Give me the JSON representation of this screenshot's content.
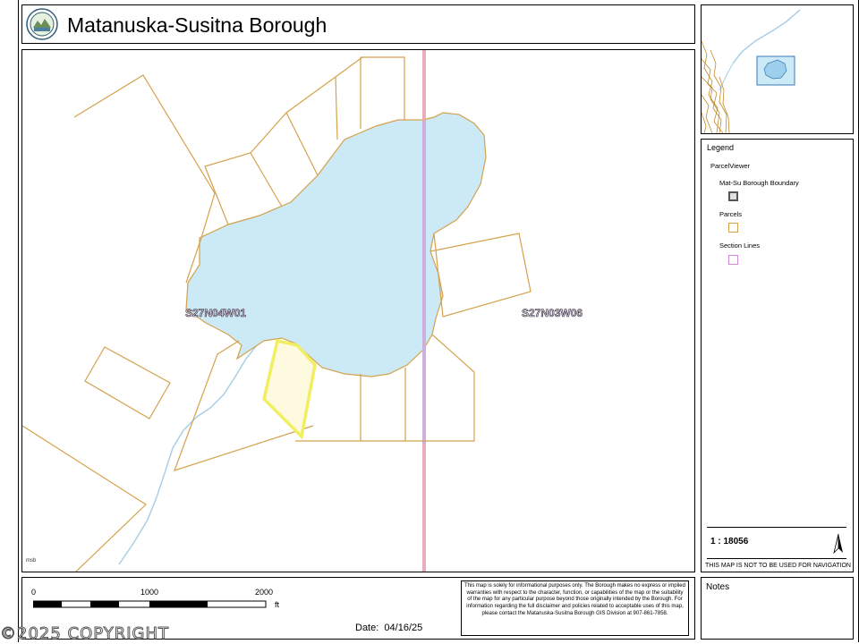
{
  "header": {
    "title": "Matanuska-Susitna Borough"
  },
  "map": {
    "section_labels": [
      "S27N04W01",
      "S27N03W06"
    ],
    "credit": "msb",
    "colors": {
      "lake": "#cce9f6",
      "parcel": "#d4a24c",
      "selected": "#f1ee62",
      "section_line": "#e4a7b4",
      "stream": "#a9cfe8"
    }
  },
  "legend": {
    "title": "Legend",
    "group": "ParcelViewer",
    "items": [
      {
        "label": "Mat-Su Borough Boundary"
      },
      {
        "label": "Parcels"
      },
      {
        "label": "Section Lines"
      }
    ],
    "scale_ratio": "1 : 18056",
    "nav_note": "THIS MAP IS NOT TO BE USED FOR NAVIGATION"
  },
  "scalebar": {
    "ticks": [
      "0",
      "1000",
      "2000"
    ],
    "unit": "ft"
  },
  "date": {
    "label": "Date:",
    "value": "04/16/25"
  },
  "disclaimer": "This map is solely for informational purposes only. The Borough makes no express or implied warranties with respect to the character, function, or capabilities of the map or the suitability of the map for any particular purpose beyond those originally intended by the Borough. For information regarding the full disclaimer and policies related to acceptable uses of this map, please contact the Matanuska-Susitna Borough GIS Division at 907-861-7858.",
  "notes": {
    "label": "Notes"
  },
  "watermark": "©2025 COPYRIGHT"
}
